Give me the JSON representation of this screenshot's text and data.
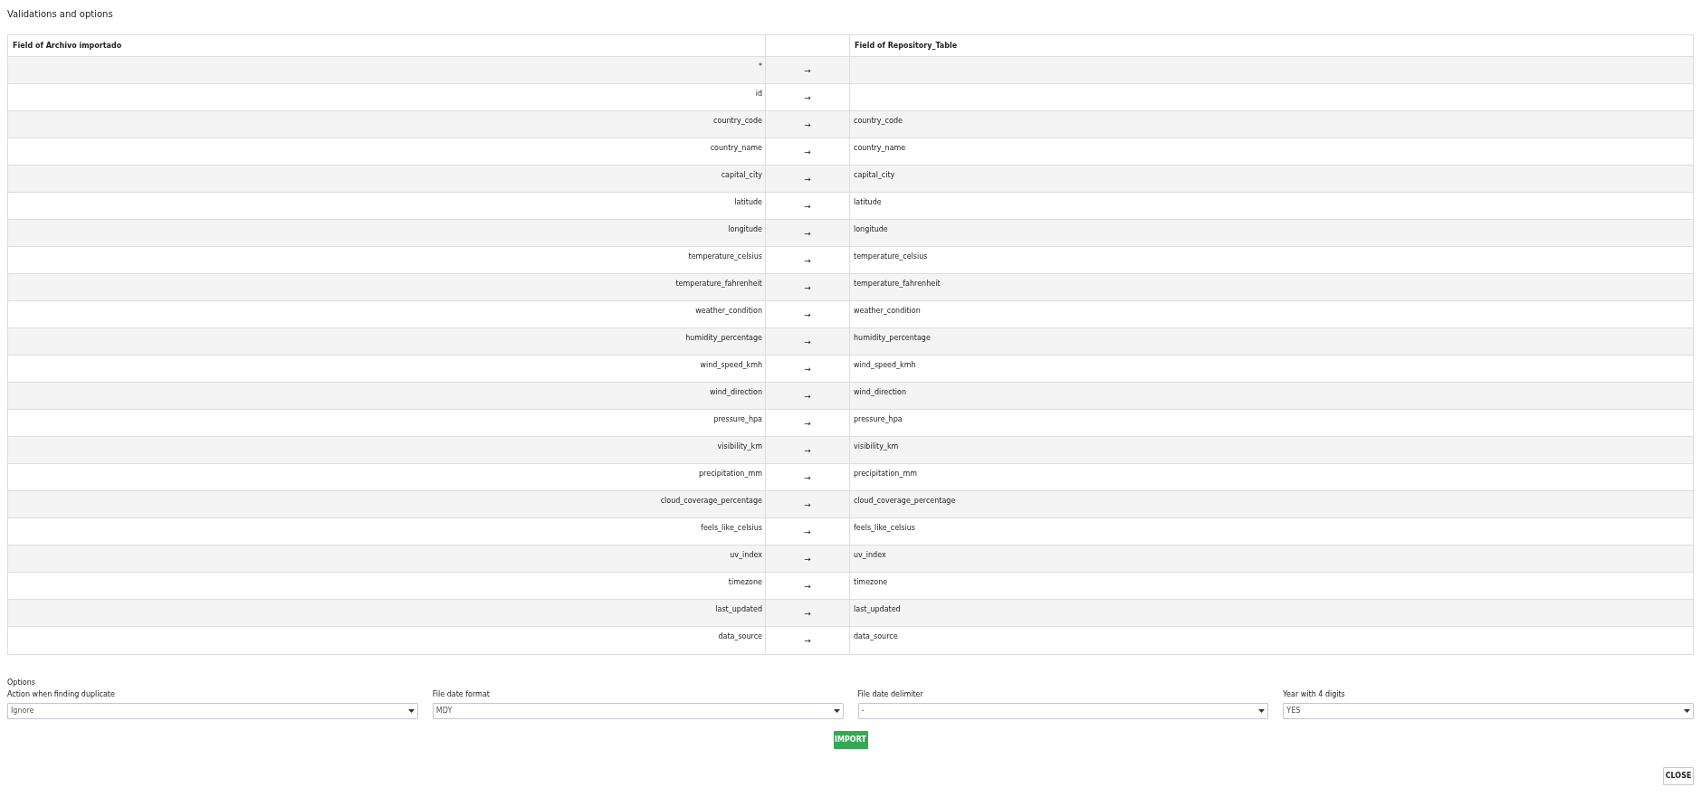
{
  "title": "Validations and options",
  "table": {
    "columns": [
      "Field of Archivo importado",
      "Field of Repository_Table"
    ],
    "rows": [
      {
        "source": "*",
        "arrow": "→",
        "target": ""
      },
      {
        "source": "id",
        "arrow": "→",
        "target": ""
      },
      {
        "source": "country_code",
        "arrow": "→",
        "target": "country_code"
      },
      {
        "source": "country_name",
        "arrow": "→",
        "target": "country_name"
      },
      {
        "source": "capital_city",
        "arrow": "→",
        "target": "capital_city"
      },
      {
        "source": "latitude",
        "arrow": "→",
        "target": "latitude"
      },
      {
        "source": "longitude",
        "arrow": "→",
        "target": "longitude"
      },
      {
        "source": "temperature_celsius",
        "arrow": "→",
        "target": "temperature_celsius"
      },
      {
        "source": "temperature_fahrenheit",
        "arrow": "→",
        "target": "temperature_fahrenheit"
      },
      {
        "source": "weather_condition",
        "arrow": "→",
        "target": "weather_condition"
      },
      {
        "source": "humidity_percentage",
        "arrow": "→",
        "target": "humidity_percentage"
      },
      {
        "source": "wind_speed_kmh",
        "arrow": "→",
        "target": "wind_speed_kmh"
      },
      {
        "source": "wind_direction",
        "arrow": "→",
        "target": "wind_direction"
      },
      {
        "source": "pressure_hpa",
        "arrow": "→",
        "target": "pressure_hpa"
      },
      {
        "source": "visibility_km",
        "arrow": "→",
        "target": "visibility_km"
      },
      {
        "source": "precipitation_mm",
        "arrow": "→",
        "target": "precipitation_mm"
      },
      {
        "source": "cloud_coverage_percentage",
        "arrow": "→",
        "target": "cloud_coverage_percentage"
      },
      {
        "source": "feels_like_celsius",
        "arrow": "→",
        "target": "feels_like_celsius"
      },
      {
        "source": "uv_index",
        "arrow": "→",
        "target": "uv_index"
      },
      {
        "source": "timezone",
        "arrow": "→",
        "target": "timezone"
      },
      {
        "source": "last_updated",
        "arrow": "→",
        "target": "last_updated"
      },
      {
        "source": "data_source",
        "arrow": "→",
        "target": "data_source"
      }
    ]
  },
  "options": {
    "heading": "Options",
    "fields": [
      {
        "label": "Action when finding duplicate",
        "value": "Ignore"
      },
      {
        "label": "File date format",
        "value": "MDY"
      },
      {
        "label": "File date delimiter",
        "value": "-"
      },
      {
        "label": "Year with 4 digits",
        "value": "YES"
      }
    ]
  },
  "buttons": {
    "import": "IMPORT",
    "close": "CLOSE"
  }
}
